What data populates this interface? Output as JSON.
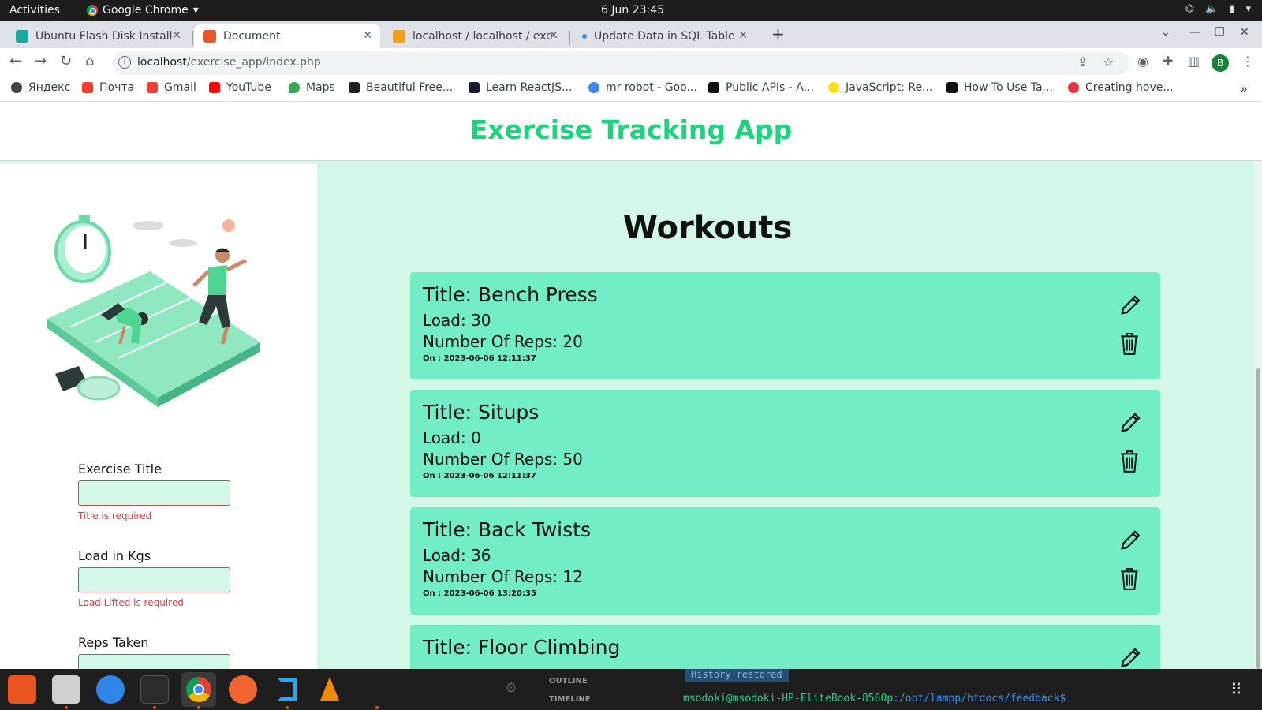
{
  "system": {
    "activities": "Activities",
    "app_menu": "Google Chrome",
    "clock": "6 Jun  23:45"
  },
  "browser": {
    "tabs": [
      {
        "title": "Ubuntu Flash Disk Install",
        "active": false,
        "favicon_color": "#1ea7a0"
      },
      {
        "title": "Document",
        "active": true,
        "favicon_color": "#e8562a"
      },
      {
        "title": "localhost / localhost / exe",
        "active": false,
        "favicon_color": "#f0a020"
      },
      {
        "title": "Update Data in SQL Table",
        "active": false,
        "favicon_color": "#3c8be0"
      }
    ],
    "url_host": "localhost",
    "url_path": "/exercise_app/index.php",
    "profile_initial": "B",
    "bookmarks": [
      {
        "label": "Яндекс",
        "color": "#444"
      },
      {
        "label": "Почта",
        "color": "#ff3b30"
      },
      {
        "label": "Gmail",
        "color": "#ea4335"
      },
      {
        "label": "YouTube",
        "color": "#ff0000"
      },
      {
        "label": "Maps",
        "color": "#34a853"
      },
      {
        "label": "Beautiful Free...",
        "color": "#222"
      },
      {
        "label": "Learn ReactJS...",
        "color": "#1a1a2e"
      },
      {
        "label": "mr robot - Goo...",
        "color": "#4285f4"
      },
      {
        "label": "Public APIs - A...",
        "color": "#111"
      },
      {
        "label": "JavaScript: Re...",
        "color": "#f7df1e"
      },
      {
        "label": "How To Use Ta...",
        "color": "#111"
      },
      {
        "label": "Creating hove...",
        "color": "#e8333c"
      }
    ]
  },
  "app": {
    "title": "Exercise Tracking App",
    "form": {
      "fields": [
        {
          "label": "Exercise Title",
          "error": "Title is required",
          "value": ""
        },
        {
          "label": "Load in Kgs",
          "error": "Load Lifted is required",
          "value": ""
        },
        {
          "label": "Reps Taken",
          "error": "",
          "value": ""
        }
      ]
    },
    "workouts_heading": "Workouts",
    "workouts": [
      {
        "title": "Title: Bench Press",
        "load": "Load: 30",
        "reps": "Number Of Reps: 20",
        "date": "On : 2023-06-06 12:11:37"
      },
      {
        "title": "Title: Situps",
        "load": "Load: 0",
        "reps": "Number Of Reps: 50",
        "date": "On : 2023-06-06 12:11:37"
      },
      {
        "title": "Title: Back Twists",
        "load": "Load: 36",
        "reps": "Number Of Reps: 12",
        "date": "On : 2023-06-06 13:20:35"
      },
      {
        "title": "Title: Floor Climbing",
        "load": "",
        "reps": "",
        "date": ""
      }
    ]
  },
  "terminal": {
    "history": "History restored",
    "outline": "OUTLINE",
    "timeline": "TIMELINE",
    "prompt_user": "msodoki@msodoki-HP-EliteBook-8560p",
    "prompt_path": ":/opt/lampp/htdocs/feedback$"
  },
  "colors": {
    "brand_green": "#1ed27e",
    "card_bg": "#72edc5",
    "panel_bg": "#d3f8e8",
    "error_red": "#e33a48"
  }
}
